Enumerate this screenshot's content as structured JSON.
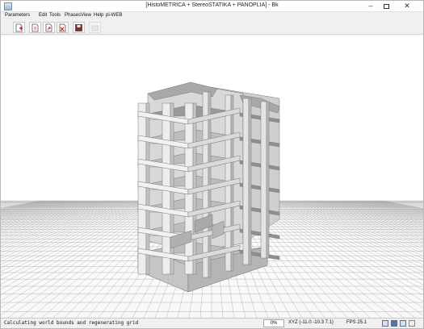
{
  "window": {
    "title": "[HistoMETRICA + StereoSTATIKA + PANOPLIA] - Bk"
  },
  "menu": {
    "items": [
      "Parameters",
      "Edit",
      "Tools",
      "Phases",
      "View",
      "Help",
      "pi-WEB"
    ]
  },
  "toolbar": {
    "buttons": [
      "new-document-icon",
      "open-document-icon",
      "export-document-icon",
      "delete-document-icon",
      "save-icon",
      "disabled-icon"
    ]
  },
  "viewport": {
    "scene": "3d-building-frame-model"
  },
  "status": {
    "message": "Calculating world bounds and regenerating grid",
    "progress_percent": 0,
    "progress_label": "0%",
    "xyz": "XYZ (-11.0 -10.3 7.1)",
    "fps": "FPS 25.1"
  }
}
